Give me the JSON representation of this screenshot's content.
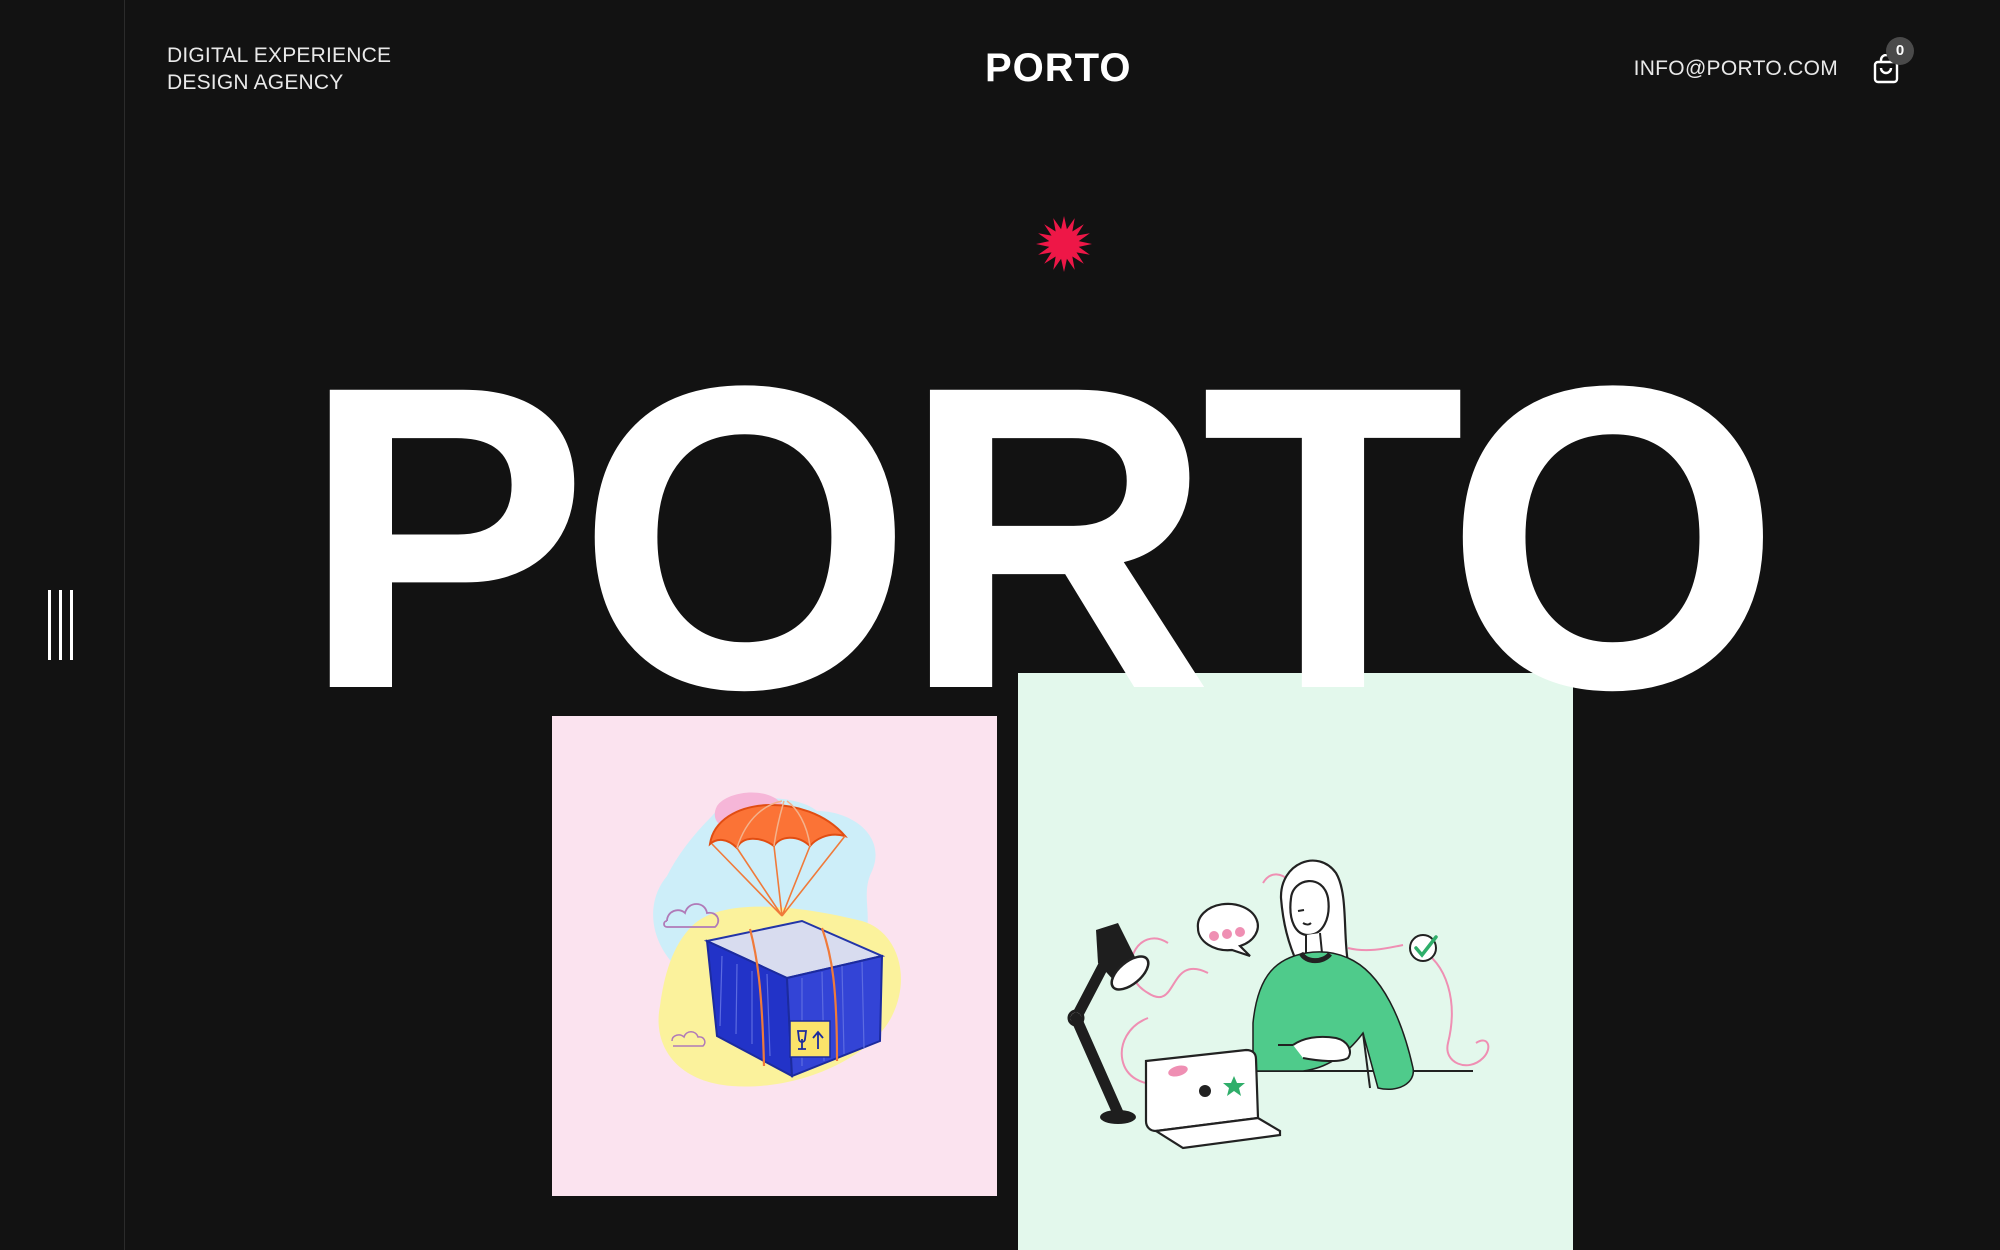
{
  "header": {
    "tagline_line1": "DIGITAL EXPERIENCE",
    "tagline_line2": "DESIGN AGENCY",
    "logo": "PORTO",
    "email": "INFO@PORTO.COM",
    "cart_count": "0"
  },
  "hero": {
    "title": "PORTO",
    "accent_color": "#ee1747"
  },
  "icons": {
    "menu": "menu-icon",
    "cart": "shopping-bag-icon",
    "accent": "starburst-icon"
  },
  "colors": {
    "background": "#121212",
    "card_pink": "#fbe3ef",
    "card_mint": "#e3f8ec",
    "text": "#ffffff"
  }
}
